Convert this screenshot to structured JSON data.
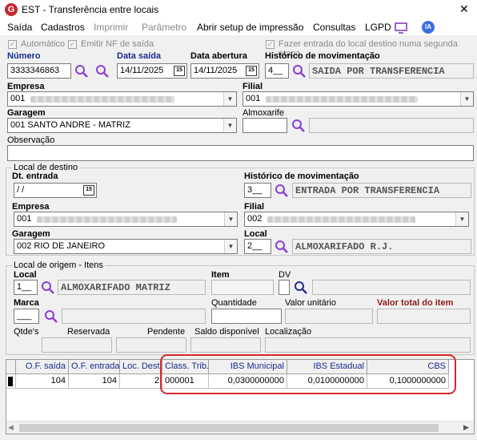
{
  "window": {
    "title": "EST - Transferência entre locais",
    "logo_text": "G"
  },
  "menu": [
    "Saída",
    "Cadastros",
    "Imprimir",
    "Parâmetro",
    "Abrir setup de impressão",
    "Consultas",
    "LGPD"
  ],
  "ia_label": "IA",
  "options": {
    "automatico": "Automático",
    "emitir_nf": "Emitir NF de saída",
    "segunda_etapa": "Fazer entrada do local destino numa segunda etapa"
  },
  "header": {
    "numero_label": "Número",
    "numero": "3333346863",
    "data_saida_label": "Data saída",
    "data_saida": "14/11/2025",
    "data_abertura_label": "Data abertura",
    "data_abertura": "14/11/2025",
    "historico_label": "Histórico de movimentação",
    "historico_code": "4__",
    "historico_desc": "SAIDA POR TRANSFERENCIA",
    "empresa_label": "Empresa",
    "empresa": "001",
    "filial_label": "Filial",
    "filial": "001",
    "garagem_label": "Garagem",
    "garagem": "001 SANTO ANDRE - MATRIZ",
    "almoxarife_label": "Almoxarife",
    "observacao_label": "Observação"
  },
  "destino": {
    "group_label": "Local de destino",
    "dt_entrada_label": "Dt. entrada",
    "dt_entrada": " / /",
    "historico_label": "Histórico de movimentação",
    "historico_code": "3__",
    "historico_desc": "ENTRADA POR TRANSFERENCIA",
    "empresa_label": "Empresa",
    "empresa": "001",
    "filial_label": "Filial",
    "filial": "002",
    "garagem_label": "Garagem",
    "garagem": "002 RIO DE JANEIRO",
    "local_label": "Local",
    "local_code": "2__",
    "local_desc": "ALMOXARIFADO R.J."
  },
  "origem": {
    "group_label": "Local de origem - Itens",
    "local_label": "Local",
    "local_code": "1__",
    "local_desc": "ALMOXARIFADO MATRIZ",
    "item_label": "Item",
    "dv_label": "DV",
    "marca_label": "Marca",
    "marca": "___",
    "quantidade_label": "Quantidade",
    "valor_unitario_label": "Valor unitário",
    "valor_total_label": "Valor total do item",
    "qtdes_label": "Qtde's",
    "reservada_label": "Reservada",
    "pendente_label": "Pendente",
    "saldo_label": "Saldo disponível",
    "localizacao_label": "Localização"
  },
  "grid": {
    "columns": [
      "O.F. saída",
      "O.F. entrada",
      "Loc. Dest",
      "Class. Trib.",
      "IBS Municipal",
      "IBS Estadual",
      "CBS"
    ],
    "rows": [
      [
        "104",
        "104",
        "2",
        "000001",
        "0,0300000000",
        "0,0100000000",
        "0,1000000000"
      ]
    ]
  },
  "colors": {
    "highlight": "#d9262c",
    "label_blue": "#1a2b8f",
    "label_red": "#8b1a1a"
  }
}
